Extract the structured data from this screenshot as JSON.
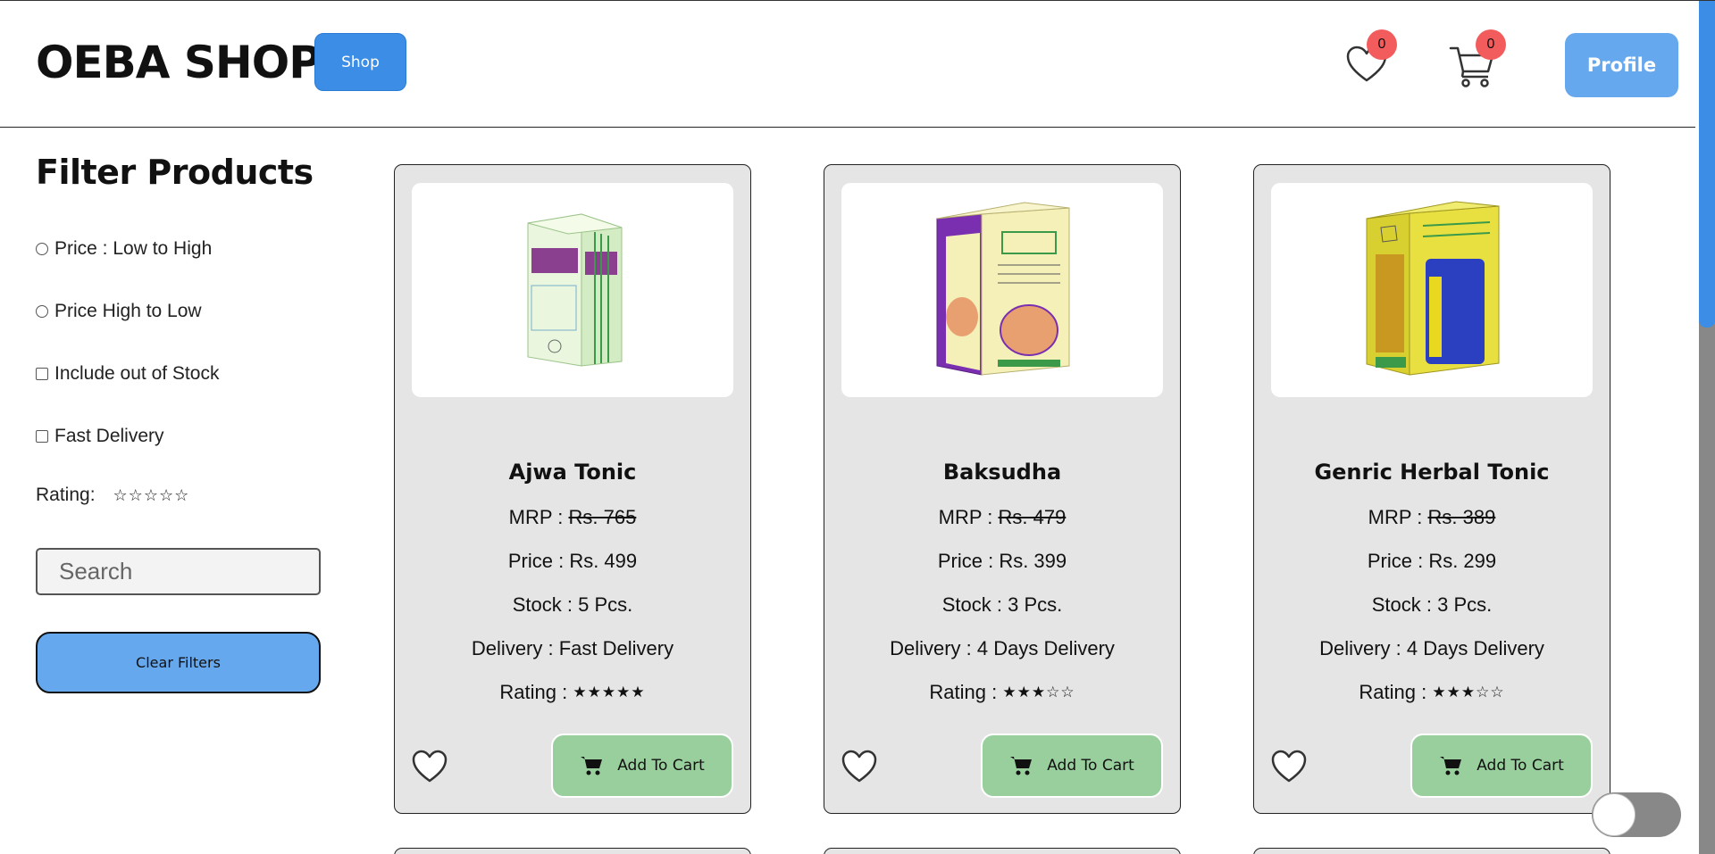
{
  "header": {
    "brand": "OEBA SHOP",
    "shop_label": "Shop",
    "wishlist_count": "0",
    "cart_count": "0",
    "profile_label": "Profile"
  },
  "filters": {
    "title": "Filter Products",
    "options": [
      {
        "label": "Price : Low to High",
        "type": "radio",
        "checked": false
      },
      {
        "label": "Price High to Low",
        "type": "radio",
        "checked": false
      },
      {
        "label": "Include out of Stock",
        "type": "checkbox",
        "checked": false
      },
      {
        "label": "Fast Delivery",
        "type": "checkbox",
        "checked": false
      }
    ],
    "rating_label": "Rating:",
    "rating_stars": "☆☆☆☆☆",
    "rating_value": 0,
    "search_placeholder": "Search",
    "clear_label": "Clear Filters"
  },
  "products": [
    {
      "name": "Ajwa Tonic",
      "mrp_label": "MRP : ",
      "mrp": "Rs. 765",
      "price": "Price : Rs. 499",
      "stock": "Stock : 5 Pcs.",
      "delivery": "Delivery : Fast Delivery",
      "rating_label": "Rating : ",
      "rating_stars": "★★★★★",
      "rating_value": 5,
      "add_label": "Add To Cart",
      "box_colors": [
        "#e8f5d8",
        "#8a3f8f",
        "#3a9a4a"
      ]
    },
    {
      "name": "Baksudha",
      "mrp_label": "MRP : ",
      "mrp": "Rs. 479",
      "price": "Price : Rs. 399",
      "stock": "Stock : 3 Pcs.",
      "delivery": "Delivery : 4 Days Delivery",
      "rating_label": "Rating : ",
      "rating_stars": "★★★☆☆",
      "rating_value": 3,
      "add_label": "Add To Cart",
      "box_colors": [
        "#f4f0b8",
        "#7a2fb0",
        "#e8a070"
      ]
    },
    {
      "name": "Genric Herbal Tonic",
      "mrp_label": "MRP : ",
      "mrp": "Rs. 389",
      "price": "Price : Rs. 299",
      "stock": "Stock : 3 Pcs.",
      "delivery": "Delivery : 4 Days Delivery",
      "rating_label": "Rating : ",
      "rating_stars": "★★★☆☆",
      "rating_value": 3,
      "add_label": "Add To Cart",
      "box_colors": [
        "#e8e040",
        "#2a40c0",
        "#d8a020"
      ]
    }
  ],
  "theme": {
    "accent": "#3b8de6",
    "profile_bg": "#66a8ee",
    "cart_button": "#98cf9c",
    "badge": "#f25c5c",
    "card_bg": "#e5e5e5"
  }
}
